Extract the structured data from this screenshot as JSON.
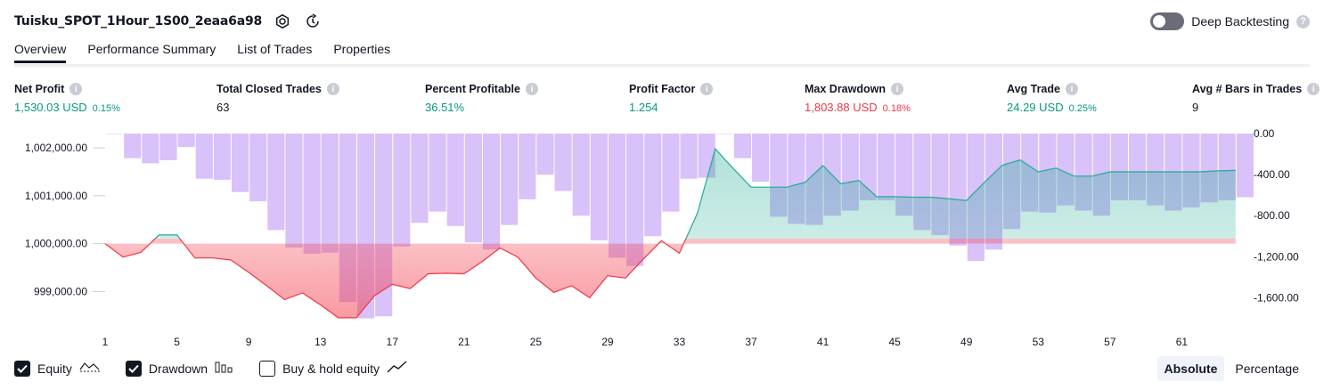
{
  "header": {
    "title": "Tuisku_SPOT_1Hour_1S00_2eaa6a98",
    "deep_backtesting_label": "Deep Backtesting"
  },
  "tabs": [
    {
      "label": "Overview",
      "active": true
    },
    {
      "label": "Performance Summary"
    },
    {
      "label": "List of Trades"
    },
    {
      "label": "Properties"
    }
  ],
  "stats": {
    "net_profit": {
      "label": "Net Profit",
      "value": "1,530.03 USD",
      "pct": "0.15%"
    },
    "total_closed_trades": {
      "label": "Total Closed Trades",
      "value": "63"
    },
    "percent_profitable": {
      "label": "Percent Profitable",
      "value": "36.51%"
    },
    "profit_factor": {
      "label": "Profit Factor",
      "value": "1.254"
    },
    "max_drawdown": {
      "label": "Max Drawdown",
      "value": "1,803.88 USD",
      "pct": "0.18%"
    },
    "avg_trade": {
      "label": "Avg Trade",
      "value": "24.29 USD",
      "pct": "0.25%"
    },
    "avg_bars": {
      "label": "Avg # Bars in Trades",
      "value": "9"
    }
  },
  "colors": {
    "positive": "#089981",
    "negative": "#f23645",
    "drawdown_bar": "#c9a6f7",
    "equity_line_up": "#22ab94",
    "equity_line_down": "#f23645"
  },
  "legend": {
    "equity": {
      "label": "Equity",
      "checked": true,
      "icon": "equity-line-icon"
    },
    "drawdown": {
      "label": "Drawdown",
      "checked": true,
      "icon": "drawdown-bars-icon"
    },
    "buy_hold": {
      "label": "Buy & hold equity",
      "checked": false,
      "icon": "buy-hold-line-icon"
    }
  },
  "modes": {
    "absolute": "Absolute",
    "percentage": "Percentage"
  },
  "chart_data": {
    "type": "line+bar",
    "x_tick_labels": [
      "1",
      "5",
      "9",
      "13",
      "17",
      "21",
      "25",
      "29",
      "33",
      "37",
      "41",
      "45",
      "49",
      "53",
      "57",
      "61"
    ],
    "left_axis": {
      "ticks": [
        "1,002,000.00",
        "1,001,000.00",
        "1,000,000.00",
        "999,000.00"
      ],
      "tick_values": [
        1002000,
        1001000,
        1000000,
        999000
      ],
      "range": [
        998430,
        1002300
      ]
    },
    "right_axis": {
      "ticks": [
        "0.00",
        "-400.00",
        "-800.00",
        "-1,200.00",
        "-1,600.00"
      ],
      "tick_values": [
        0,
        -400,
        -800,
        -1200,
        -1600
      ],
      "range": [
        -1803.88,
        0
      ]
    },
    "equity": {
      "name": "Equity",
      "x": [
        1,
        2,
        3,
        4,
        5,
        6,
        7,
        8,
        9,
        10,
        11,
        12,
        13,
        14,
        15,
        16,
        17,
        18,
        19,
        20,
        21,
        22,
        23,
        24,
        25,
        26,
        27,
        28,
        29,
        30,
        31,
        32,
        33,
        34,
        35,
        36,
        37,
        38,
        39,
        40,
        41,
        42,
        43,
        44,
        45,
        46,
        47,
        48,
        49,
        50,
        51,
        52,
        53,
        54,
        55,
        56,
        57,
        58,
        59,
        60,
        61,
        62,
        63,
        64
      ],
      "values": [
        1000000,
        999720,
        999820,
        1000180,
        1000180,
        999700,
        999700,
        999660,
        999400,
        999120,
        998830,
        998970,
        998720,
        998450,
        998450,
        998910,
        999150,
        999060,
        999370,
        999380,
        999370,
        999620,
        999910,
        999720,
        999280,
        998980,
        999120,
        998870,
        999330,
        999280,
        999680,
        1000060,
        999800,
        1000630,
        1001980,
        1001570,
        1001180,
        1001180,
        1001180,
        1001280,
        1001630,
        1001250,
        1001320,
        1000980,
        1000980,
        1000970,
        1000970,
        1000940,
        1000900,
        1001280,
        1001640,
        1001750,
        1001500,
        1001580,
        1001410,
        1001410,
        1001500,
        1001500,
        1001500,
        1001500,
        1001500,
        1001500,
        1001520,
        1001530
      ]
    },
    "drawdown": {
      "name": "Drawdown",
      "x": [
        1,
        2,
        3,
        4,
        5,
        6,
        7,
        8,
        9,
        10,
        11,
        12,
        13,
        14,
        15,
        16,
        17,
        18,
        19,
        20,
        21,
        22,
        23,
        24,
        25,
        26,
        27,
        28,
        29,
        30,
        31,
        32,
        33,
        34,
        35,
        36,
        37,
        38,
        39,
        40,
        41,
        42,
        43,
        44,
        45,
        46,
        47,
        48,
        49,
        50,
        51,
        52,
        53,
        54,
        55,
        56,
        57,
        58,
        59,
        60,
        61,
        62,
        63,
        64
      ],
      "values": [
        0,
        -240,
        -290,
        -260,
        -130,
        -440,
        -450,
        -570,
        -660,
        -940,
        -1110,
        -1170,
        -1160,
        -1640,
        -1800,
        -1780,
        -1100,
        -870,
        -760,
        -900,
        -1060,
        -1130,
        -890,
        -640,
        -400,
        -560,
        -800,
        -1040,
        -1210,
        -1290,
        -1000,
        -760,
        -440,
        -430,
        0,
        -240,
        -470,
        -810,
        -880,
        -890,
        -800,
        -750,
        -650,
        -650,
        -800,
        -940,
        -990,
        -1090,
        -1240,
        -1130,
        -930,
        -760,
        -770,
        -700,
        -750,
        -800,
        -650,
        -650,
        -700,
        -750,
        -720,
        -670,
        -650,
        -620
      ]
    }
  }
}
